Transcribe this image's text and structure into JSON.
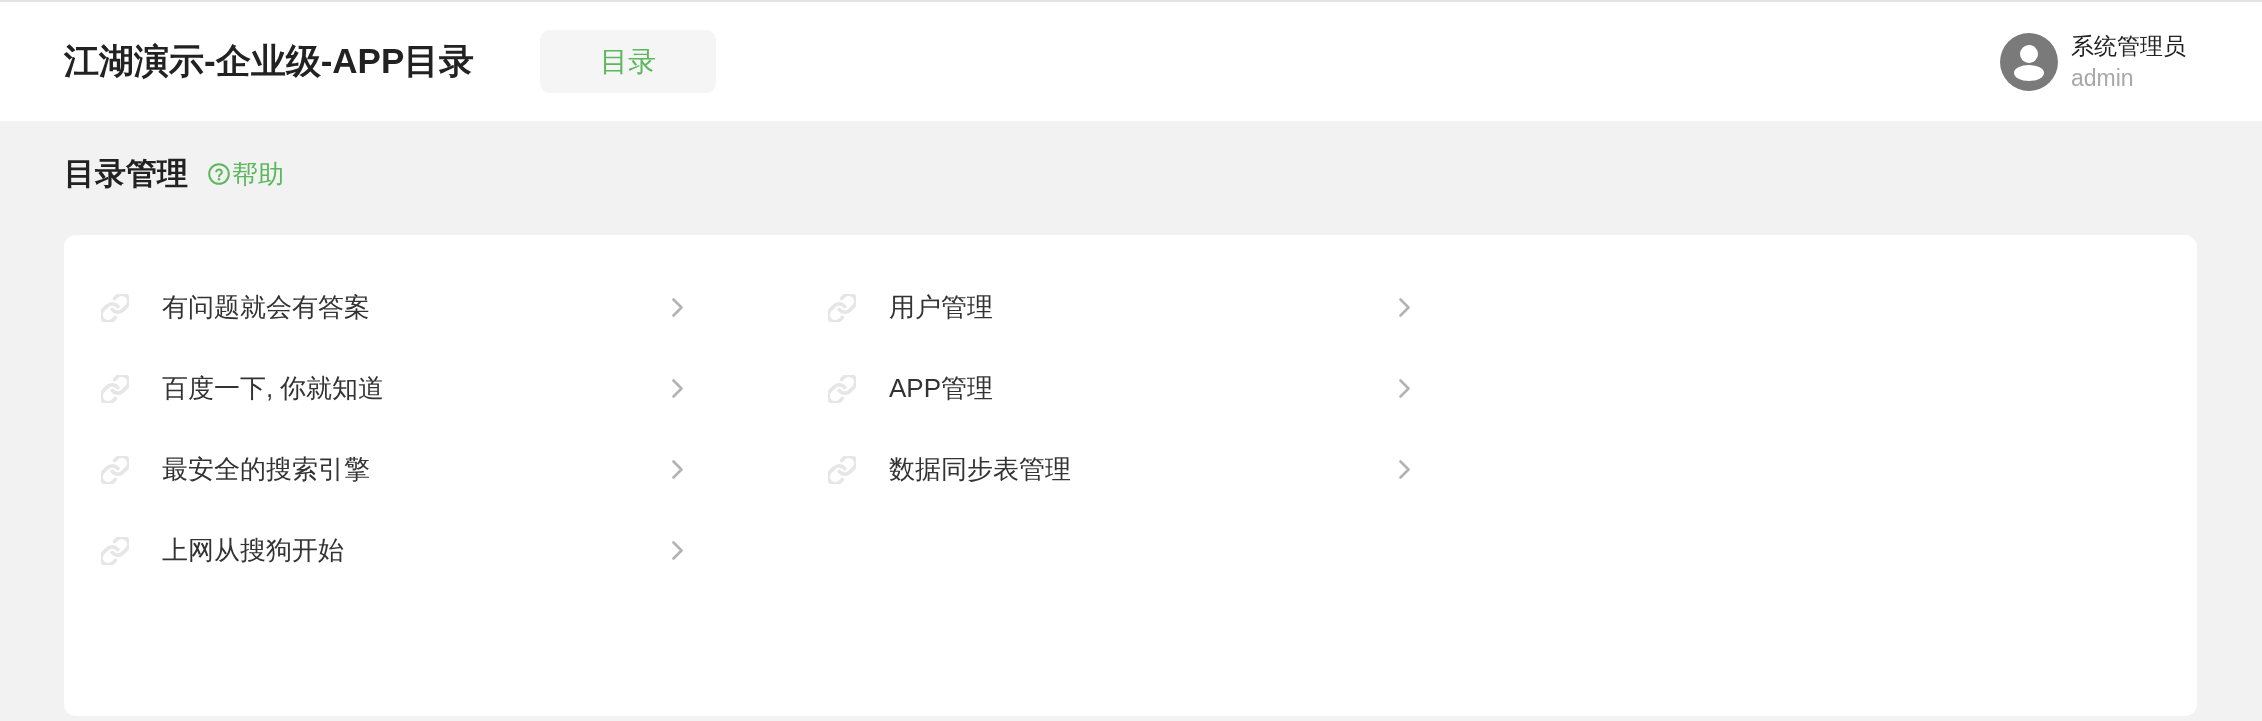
{
  "header": {
    "title": "江湖演示-企业级-APP目录",
    "nav_tabs": [
      {
        "label": "目录",
        "selected": true
      }
    ],
    "user": {
      "name": "系统管理员",
      "account": "admin"
    }
  },
  "page": {
    "title": "目录管理",
    "help_link": "帮助"
  },
  "directory": {
    "columns": [
      {
        "items": [
          {
            "label": "有问题就会有答案"
          },
          {
            "label": "百度一下, 你就知道"
          },
          {
            "label": "最安全的搜索引擎"
          },
          {
            "label": "上网从搜狗开始"
          }
        ]
      },
      {
        "items": [
          {
            "label": "用户管理"
          },
          {
            "label": "APP管理"
          },
          {
            "label": "数据同步表管理"
          }
        ]
      }
    ]
  }
}
